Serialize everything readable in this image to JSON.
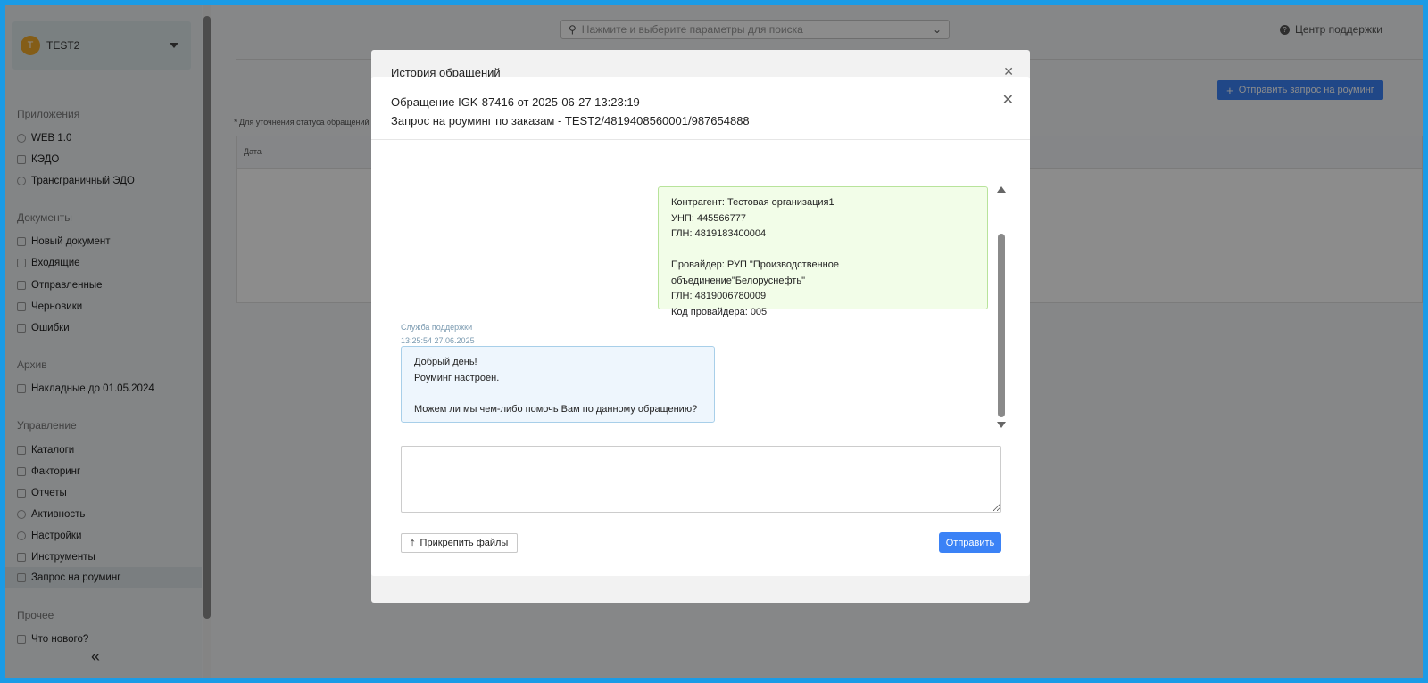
{
  "sidebar": {
    "org_initial": "T",
    "org_name": "TEST2",
    "sections": {
      "apps": "Приложения",
      "docs": "Документы",
      "archive": "Архив",
      "manage": "Управление",
      "other": "Прочее"
    },
    "apps": [
      "WEB 1.0",
      "КЭДО",
      "Трансграничный ЭДО"
    ],
    "docs": [
      "Новый документ",
      "Входящие",
      "Отправленные",
      "Черновики",
      "Ошибки"
    ],
    "archive": [
      "Накладные до 01.05.2024"
    ],
    "manage": [
      "Каталоги",
      "Факторинг",
      "Отчеты",
      "Активность",
      "Настройки",
      "Инструменты",
      "Запрос на роуминг"
    ],
    "other": [
      "Что нового?"
    ]
  },
  "header": {
    "search_placeholder": "Нажмите и выберите параметры для поиска",
    "support": "Центр поддержки"
  },
  "main": {
    "roaming_button": "Отправить запрос на роуминг",
    "note": "* Для уточнения статуса обращений",
    "col_date": "Дата"
  },
  "history_modal": {
    "title": "История обращений"
  },
  "ticket_modal": {
    "title_line1": "Обращение IGK-87416 от 2025-06-27 13:23:19",
    "title_line2": "Запрос на роуминг по заказам - TEST2/4819408560001/987654888",
    "outgoing_lines": [
      "Контрагент: Тестовая организация1",
      "УНП: 445566777",
      "ГЛН: 4819183400004",
      "",
      "Провайдер: РУП \"Производственное объединение\"Белоруснефть\"",
      "ГЛН: 4819006780009",
      "Код провайдера: 005"
    ],
    "incoming_author": "Служба поддержки",
    "incoming_time": "13:25:54 27.06.2025",
    "incoming_lines": [
      "Добрый день!",
      "Роуминг настроен.",
      "",
      "Можем ли мы чем-либо помочь Вам по данному обращению?"
    ],
    "attach_label": "Прикрепить файлы",
    "send_label": "Отправить"
  },
  "colors": {
    "accent": "#3b82f6",
    "outgoing_bg": "#f2fde8",
    "incoming_bg": "#eef6fd"
  }
}
